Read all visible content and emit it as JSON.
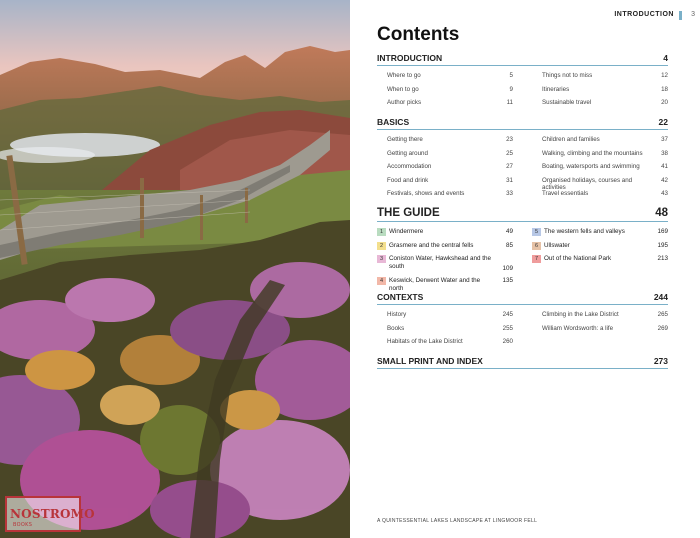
{
  "header": {
    "running_head": "INTRODUCTION",
    "page_number": "3",
    "title": "Contents"
  },
  "sections": [
    {
      "heading": "INTRODUCTION",
      "page": "4",
      "left": [
        {
          "label": "Where to go",
          "page": "5"
        },
        {
          "label": "When to go",
          "page": "9"
        },
        {
          "label": "Author picks",
          "page": "11"
        }
      ],
      "right": [
        {
          "label": "Things not to miss",
          "page": "12"
        },
        {
          "label": "Itineraries",
          "page": "18"
        },
        {
          "label": "Sustainable travel",
          "page": "20"
        }
      ]
    },
    {
      "heading": "BASICS",
      "page": "22",
      "left": [
        {
          "label": "Getting there",
          "page": "23"
        },
        {
          "label": "Getting around",
          "page": "25"
        },
        {
          "label": "Accommodation",
          "page": "27"
        },
        {
          "label": "Food and drink",
          "page": "31"
        },
        {
          "label": "Festivals, shows and events",
          "page": "33"
        }
      ],
      "right": [
        {
          "label": "Children and families",
          "page": "37"
        },
        {
          "label": "Walking, climbing and the mountains",
          "page": "38"
        },
        {
          "label": "Boating, watersports and swimming",
          "page": "41"
        },
        {
          "label": "Organised holidays, courses and activities",
          "page": "42"
        },
        {
          "label": "Travel essentials",
          "page": "43"
        }
      ]
    },
    {
      "heading": "THE GUIDE",
      "page": "48",
      "left": [
        {
          "num": "1",
          "label": "Windermere",
          "page": "49",
          "color": "#b9dcc0"
        },
        {
          "num": "2",
          "label": "Grasmere and the central fells",
          "page": "85",
          "color": "#f3df8d"
        },
        {
          "num": "3",
          "label": "Coniston Water, Hawkshead and the south",
          "page": "109",
          "color": "#e8b8d6"
        },
        {
          "num": "4",
          "label": "Keswick, Derwent Water and the north",
          "page": "135",
          "color": "#f2b8a8"
        }
      ],
      "right": [
        {
          "num": "5",
          "label": "The western fells and valleys",
          "page": "169",
          "color": "#b8c8e6"
        },
        {
          "num": "6",
          "label": "Ullswater",
          "page": "195",
          "color": "#e6c2a6"
        },
        {
          "num": "7",
          "label": "Out of the National Park",
          "page": "213",
          "color": "#ef9c9c"
        }
      ]
    },
    {
      "heading": "CONTEXTS",
      "page": "244",
      "left": [
        {
          "label": "History",
          "page": "245"
        },
        {
          "label": "Books",
          "page": "255"
        },
        {
          "label": "Habitats of the Lake District",
          "page": "260"
        }
      ],
      "right": [
        {
          "label": "Climbing in the Lake District",
          "page": "265"
        },
        {
          "label": "William Wordsworth: a life",
          "page": "269"
        }
      ]
    },
    {
      "heading": "SMALL PRINT AND INDEX",
      "page": "273",
      "left": [],
      "right": []
    }
  ],
  "caption": "A QUINTESSENTIAL LAKES LANDSCAPE AT LINGMOOR FELL",
  "watermark": {
    "text": "NOSTROMO",
    "sub": "BOOKS"
  },
  "colors": {
    "rule": "#7ab0c8"
  }
}
